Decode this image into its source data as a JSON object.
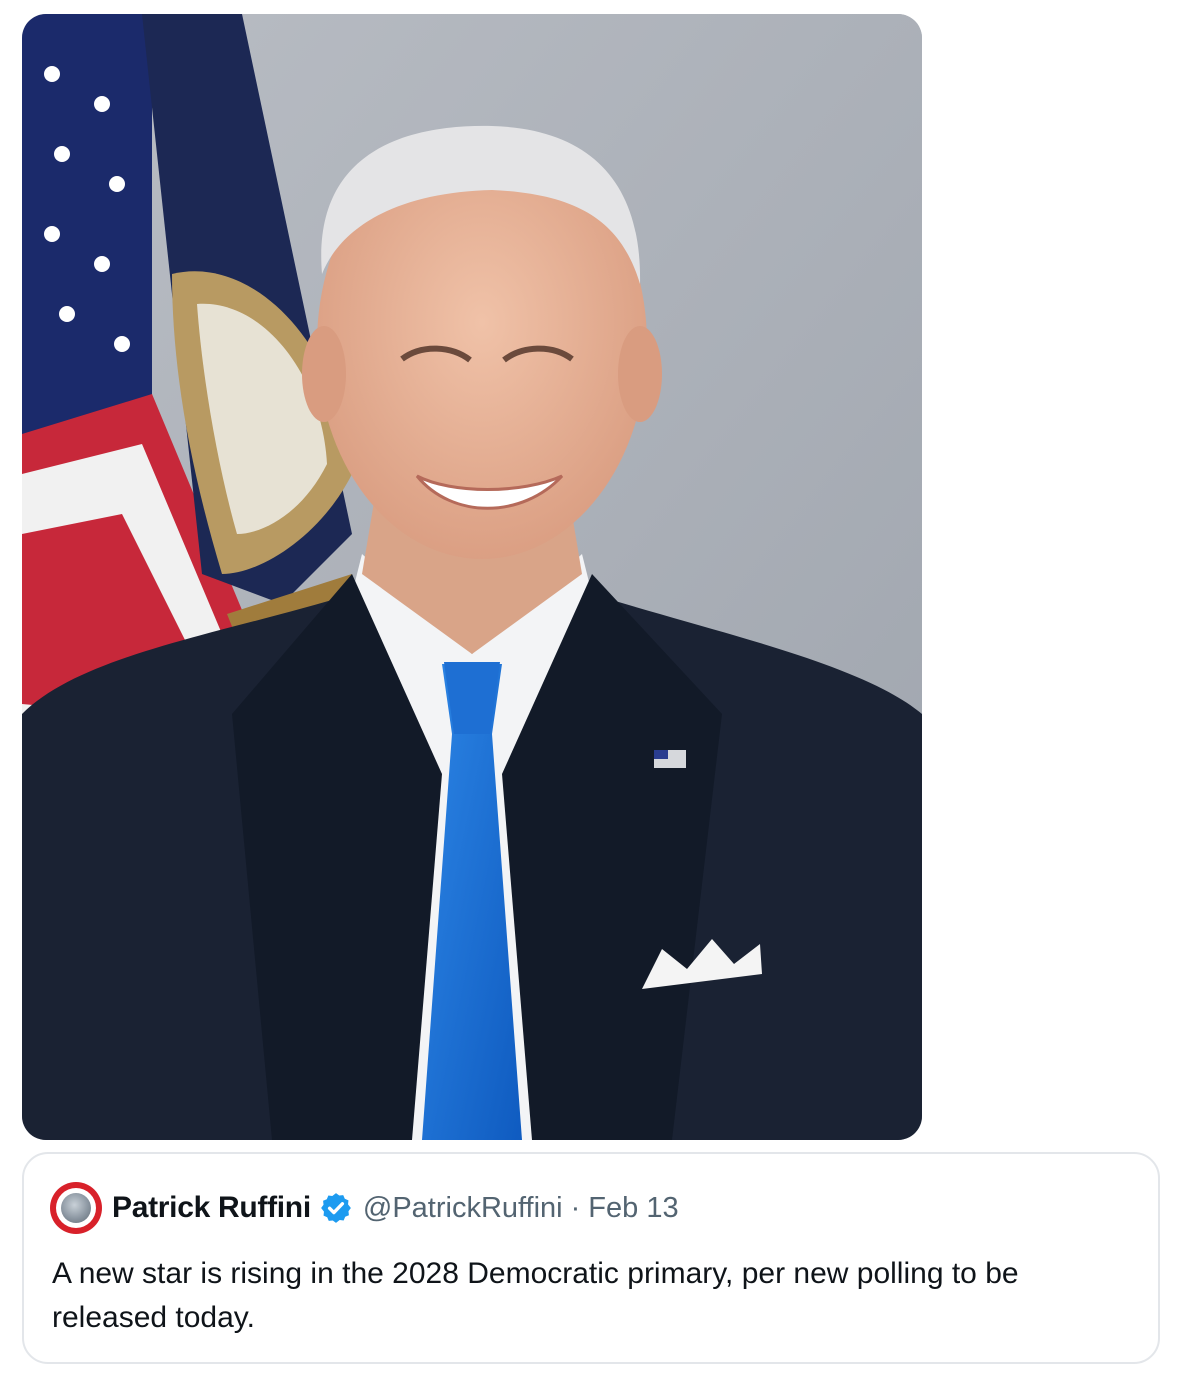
{
  "quote": {
    "author_name": "Patrick Ruffini",
    "handle": "@PatrickRuffini",
    "separator": "·",
    "date": "Feb 13",
    "text": "A new star is rising in the 2028 Democratic primary, per new polling to be released today."
  },
  "colors": {
    "name_text": "#0f1419",
    "secondary_text": "#536471",
    "verified_badge": "#1d9bf0",
    "card_border": "#e3e6ea",
    "avatar_ring": "#d8212a"
  },
  "icons": {
    "verified": "verified-badge-icon",
    "avatar": "profile-avatar"
  }
}
